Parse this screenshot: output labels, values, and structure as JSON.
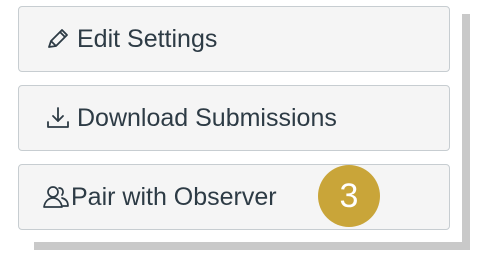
{
  "menu": {
    "edit_settings": {
      "label": "Edit Settings",
      "icon": "pencil-icon"
    },
    "download_submissions": {
      "label": "Download Submissions",
      "icon": "download-icon"
    },
    "pair_with_observer": {
      "label": "Pair with Observer",
      "icon": "user-pair-icon"
    }
  },
  "annotation": {
    "step": "3",
    "color": "#c9a539"
  }
}
